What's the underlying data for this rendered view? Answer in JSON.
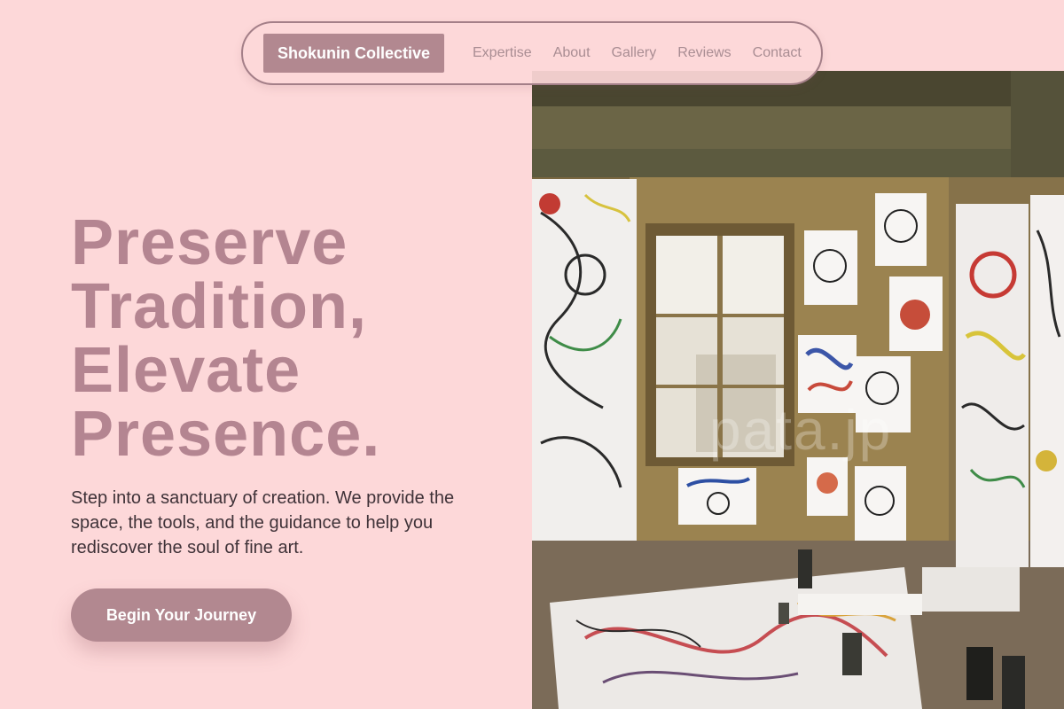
{
  "nav": {
    "brand": "Shokunin Collective",
    "links": [
      "Expertise",
      "About",
      "Gallery",
      "Reviews",
      "Contact"
    ]
  },
  "hero": {
    "title_lines": [
      "Preserve",
      "Tradition,",
      "Elevate",
      "Presence."
    ],
    "subtitle": "Step into a sanctuary of creation. We provide the space, the tools, and the guidance to help you rediscover the soul of fine art.",
    "cta": "Begin Your Journey"
  },
  "image": {
    "watermark": "pata.jp"
  },
  "colors": {
    "background": "#fdd8d9",
    "accent": "#b28890",
    "title": "#b48591",
    "body_text": "#3f3238",
    "nav_link": "#a98d93"
  }
}
